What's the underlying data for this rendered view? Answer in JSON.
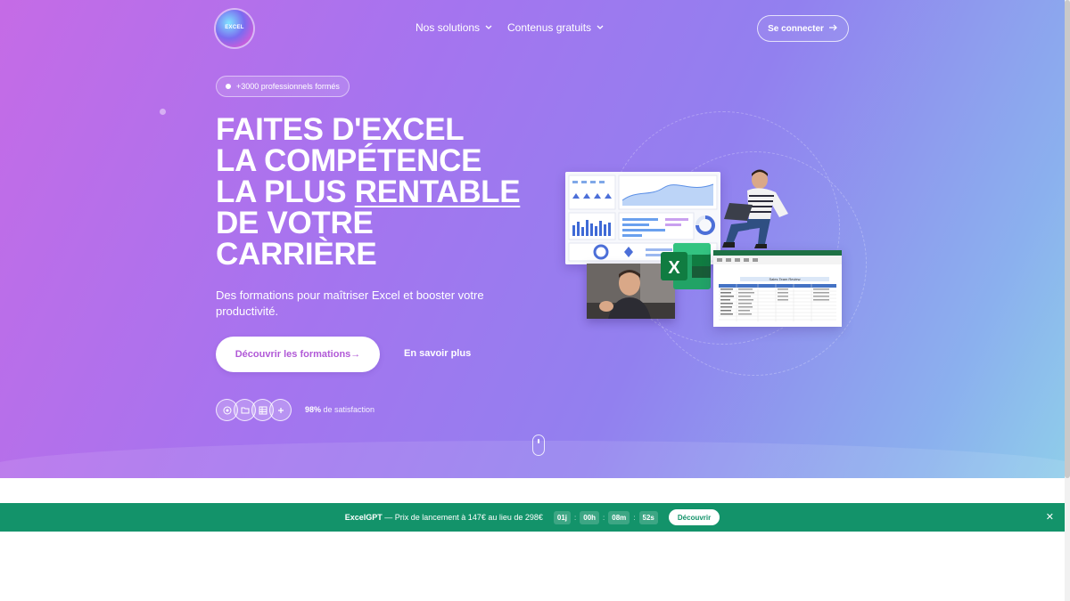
{
  "header": {
    "logo_text": "EXCEL",
    "nav": [
      {
        "label": "Nos solutions"
      },
      {
        "label": "Contenus gratuits"
      }
    ],
    "login_label": "Se connecter"
  },
  "hero": {
    "badge": "+3000 professionnels formés",
    "headline_lines": [
      "FAITES D'EXCEL",
      "LA COMPÉTENCE",
      "LA PLUS ",
      "RENTABLE",
      "DE VOTRE",
      "CARRIÈRE"
    ],
    "subtitle": "Des formations pour maîtriser Excel et booster votre productivité.",
    "cta_primary": "Découvrir les formations",
    "cta_primary_arrow": "→",
    "cta_secondary": "En savoir plus",
    "satisfaction_value": "98%",
    "satisfaction_label": " de satisfaction",
    "feature_icons": [
      "target-icon",
      "folder-icon",
      "spreadsheet-icon",
      "plus-icon"
    ],
    "illustration": {
      "excel_letter": "X",
      "sheet_title": "Sales Team Review"
    }
  },
  "promo_banner": {
    "product": "ExcelGPT",
    "text": " — Prix de lancement à 147€ au lieu de 298€",
    "countdown": [
      "01j",
      "00h",
      "08m",
      "52s"
    ],
    "separator": ":",
    "button": "Découvrir",
    "close": "✕"
  },
  "colors": {
    "hero_start": "#c56be6",
    "hero_end": "#8fcdea",
    "cta_text": "#b159d7",
    "banner_bg": "#13936a"
  }
}
